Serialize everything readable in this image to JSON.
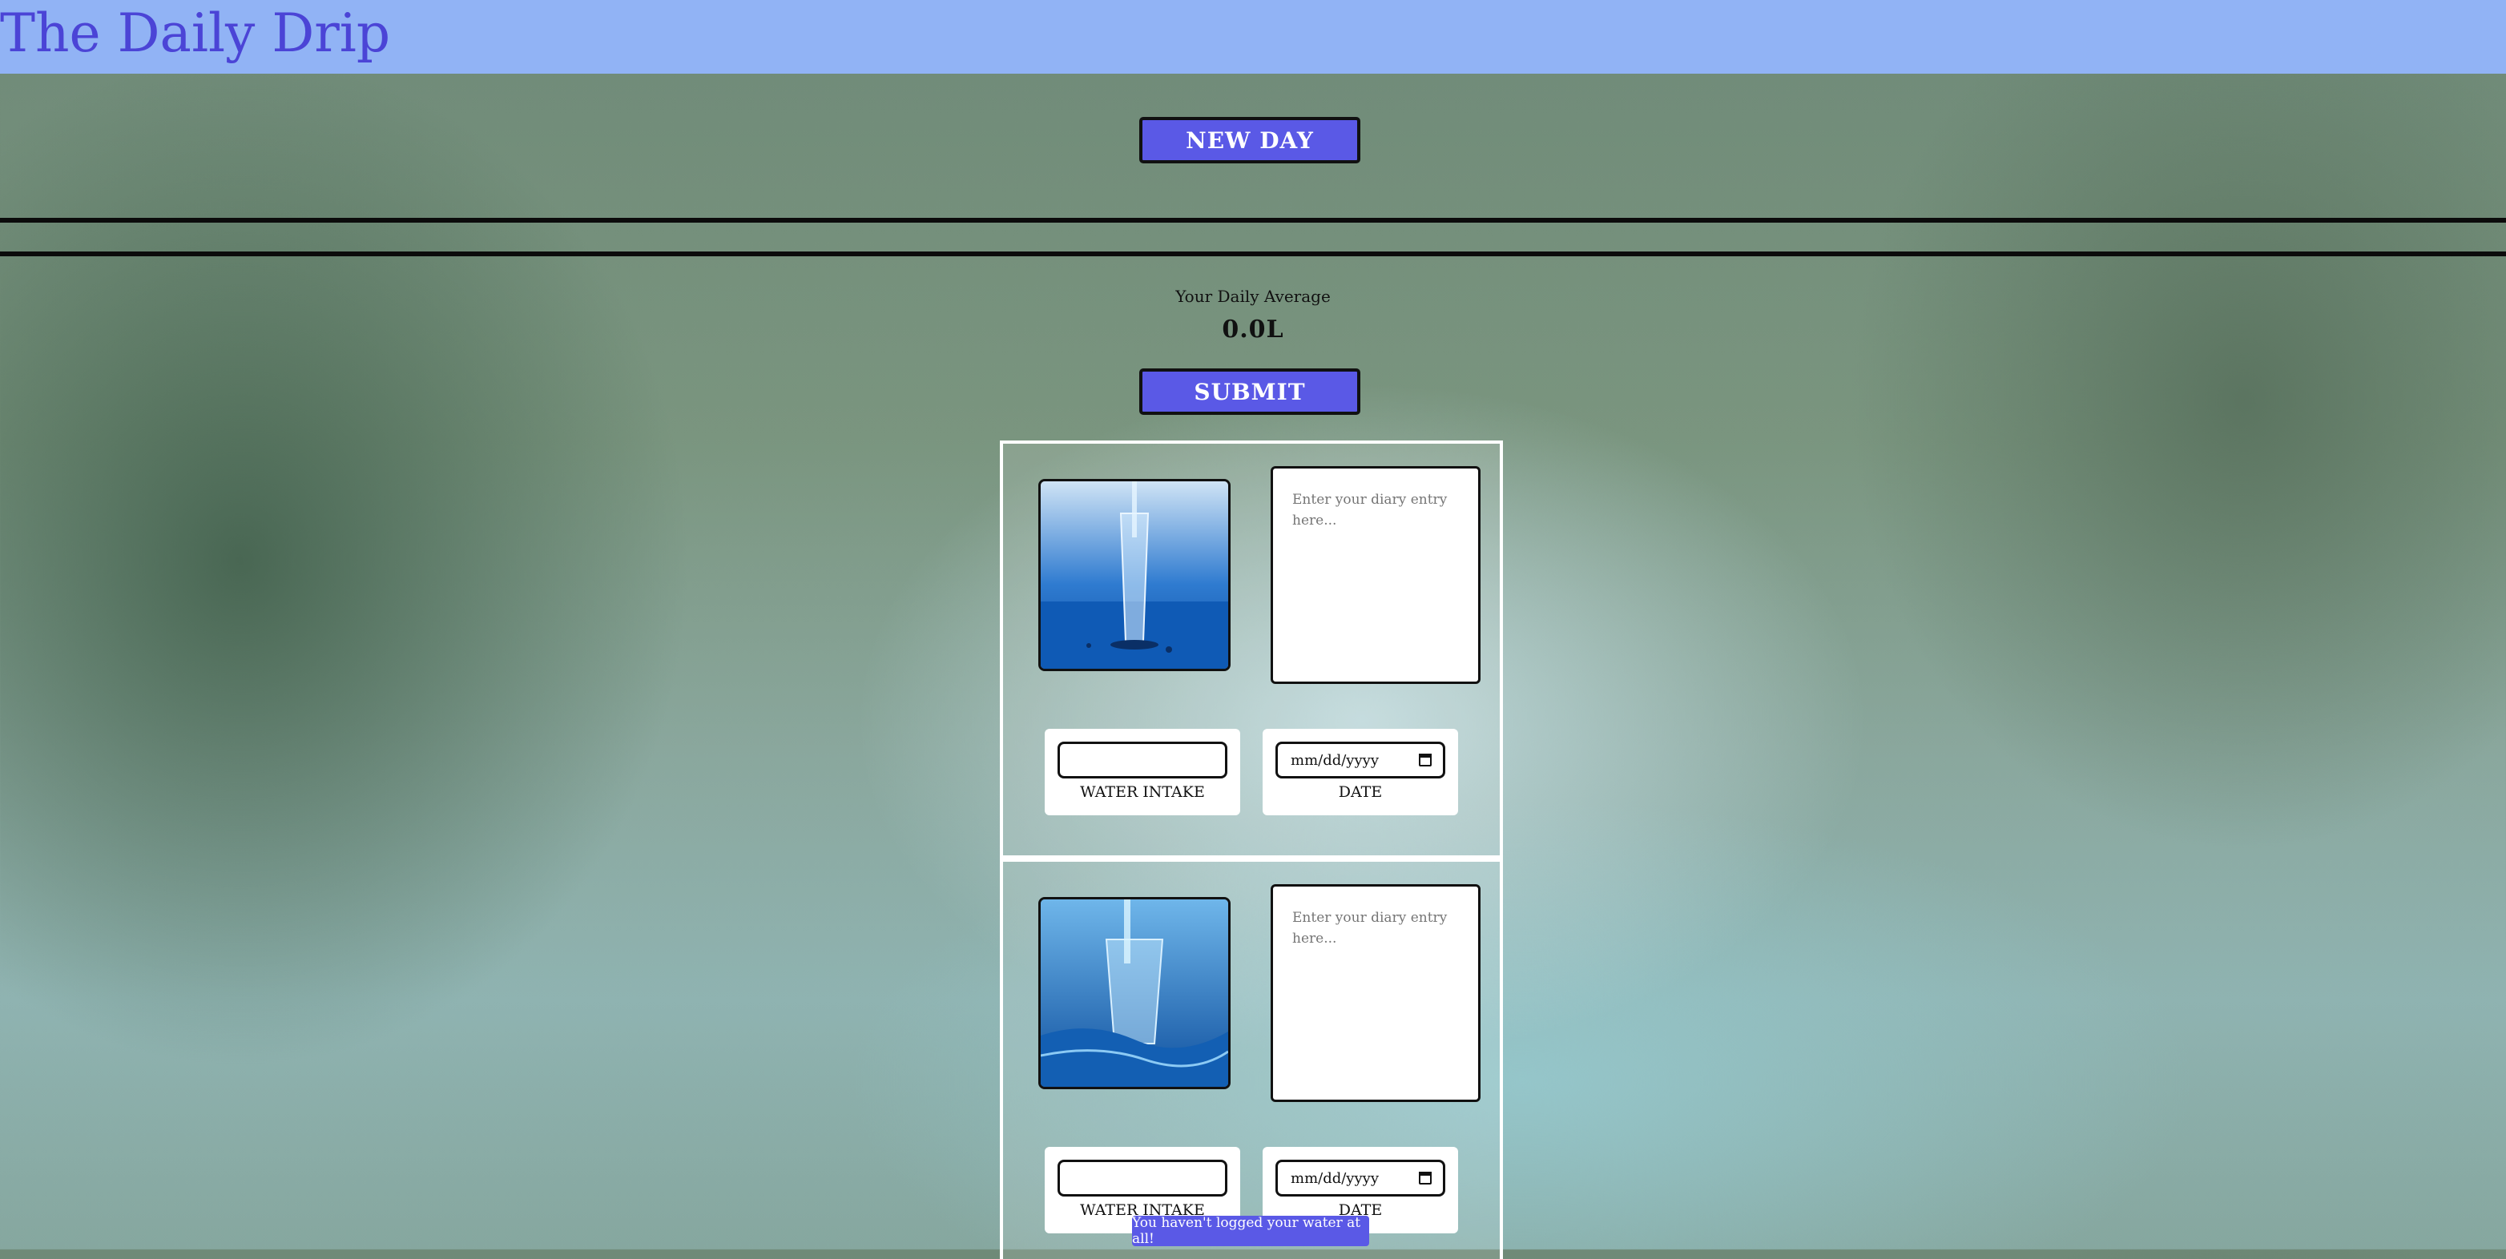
{
  "header": {
    "title": "The Daily Drip"
  },
  "actions": {
    "new_day_label": "NEW DAY",
    "submit_label": "SUBMIT"
  },
  "stats": {
    "average_label": "Your Daily Average",
    "average_value": "0.0L"
  },
  "entries": [
    {
      "diary_placeholder": "Enter your diary entry here...",
      "intake_label": "WATER INTAKE",
      "date_placeholder": "mm/dd/yyyy",
      "date_label": "DATE",
      "image": "water-glass-pour-ocean"
    },
    {
      "diary_placeholder": "Enter your diary entry here...",
      "intake_label": "WATER INTAKE",
      "date_placeholder": "mm/dd/yyyy",
      "date_label": "DATE",
      "image": "water-glass-splash"
    }
  ],
  "notification": {
    "text": "You haven't logged your water at all!"
  },
  "icons": {
    "date_picker": "calendar-icon"
  },
  "colors": {
    "header_bg": "#91b3f5",
    "title": "#4b44d6",
    "button": "#5a59e6"
  }
}
